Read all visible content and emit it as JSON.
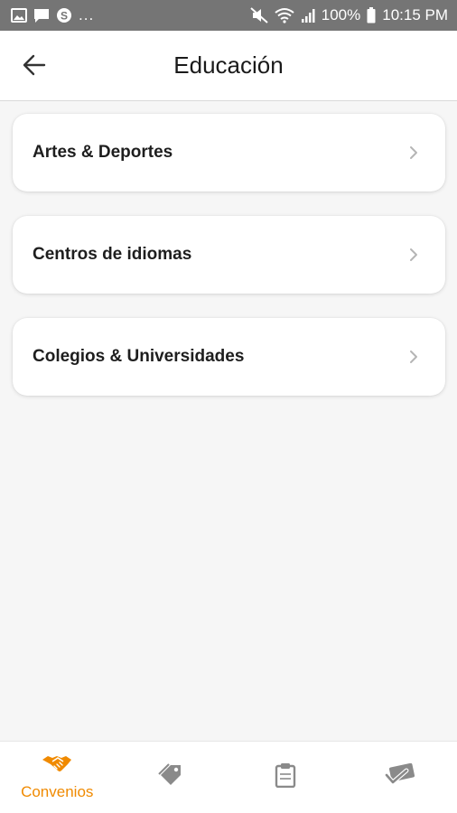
{
  "status_bar": {
    "battery": "100%",
    "time": "10:15 PM",
    "more": "..."
  },
  "header": {
    "title": "Educación"
  },
  "categories": [
    {
      "label": "Artes & Deportes"
    },
    {
      "label": "Centros de idiomas"
    },
    {
      "label": "Colegios & Universidades"
    }
  ],
  "bottom_nav": {
    "items": [
      {
        "label": "Convenios",
        "icon": "handshake-icon",
        "active": true
      },
      {
        "label": "",
        "icon": "tag-icon",
        "active": false
      },
      {
        "label": "",
        "icon": "clipboard-icon",
        "active": false
      },
      {
        "label": "",
        "icon": "card-check-icon",
        "active": false
      }
    ]
  },
  "colors": {
    "accent": "#f08a00",
    "status_bar": "#757575",
    "inactive_icon": "#8a8a8a"
  }
}
